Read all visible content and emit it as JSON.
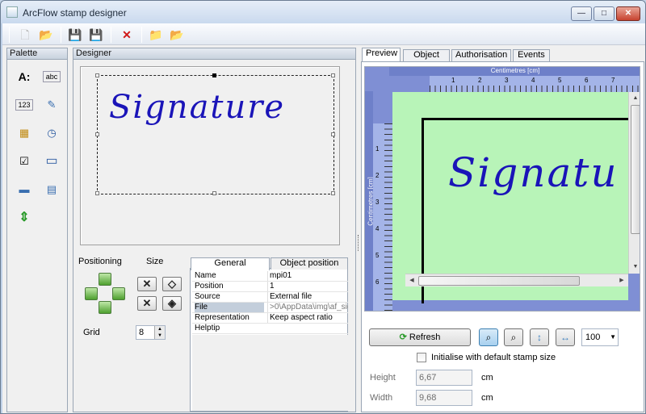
{
  "window": {
    "title": "ArcFlow stamp designer",
    "controls": {
      "minimize": "—",
      "maximize": "□",
      "close": "✕"
    }
  },
  "toolbar": {
    "new": "🗋",
    "open": "📂",
    "save": "💾",
    "save_as": "💾",
    "delete": "✕",
    "import": "📁",
    "export": "📂"
  },
  "palette": {
    "title": "Palette",
    "items": [
      {
        "name": "label",
        "glyph": "A:"
      },
      {
        "name": "textbox",
        "glyph": "abc"
      },
      {
        "name": "number",
        "glyph": "123"
      },
      {
        "name": "memo",
        "glyph": "✎"
      },
      {
        "name": "date",
        "glyph": "▦"
      },
      {
        "name": "time",
        "glyph": "◷"
      },
      {
        "name": "checkbox",
        "glyph": "☑"
      },
      {
        "name": "panel",
        "glyph": "▭"
      },
      {
        "name": "image",
        "glyph": "▬"
      },
      {
        "name": "signature",
        "glyph": "▤"
      },
      {
        "name": "splitter",
        "glyph": "⇕"
      }
    ]
  },
  "designer": {
    "title": "Designer",
    "stamp_text": "Signature",
    "positioning_label": "Positioning",
    "size_label": "Size",
    "grid_label": "Grid",
    "grid_value": "8"
  },
  "properties": {
    "tabs": [
      "General",
      "Object position"
    ],
    "rows": [
      {
        "key": "Name",
        "value": "mpi01"
      },
      {
        "key": "Position",
        "value": "1"
      },
      {
        "key": "Source",
        "value": "External file"
      },
      {
        "key": "File",
        "value": ">0\\AppData\\img\\af_sig"
      },
      {
        "key": "Representation",
        "value": "Keep aspect ratio"
      },
      {
        "key": "Helptip",
        "value": ""
      }
    ]
  },
  "right_tabs": [
    "Preview",
    "Object tree",
    "Authorisation",
    "Events"
  ],
  "preview": {
    "ruler_title": "Centimetres [cm]",
    "vruler_title": "Centimetres [cm]",
    "h_ticks": [
      "1",
      "2",
      "3",
      "4",
      "5",
      "6",
      "7"
    ],
    "v_ticks": [
      "1",
      "2",
      "3",
      "4",
      "5",
      "6"
    ],
    "stamp_text": "Signatu"
  },
  "controls": {
    "refresh_label": "Refresh",
    "zoom_value": "100",
    "init_checkbox_label": "Initialise with default stamp size",
    "height_label": "Height",
    "height_value": "6,67",
    "width_label": "Width",
    "width_value": "9,68",
    "unit": "cm"
  },
  "colors": {
    "accent": "#1a14b8",
    "preview_bg": "#b8f4b8",
    "ruler": "#a4b4e8"
  }
}
